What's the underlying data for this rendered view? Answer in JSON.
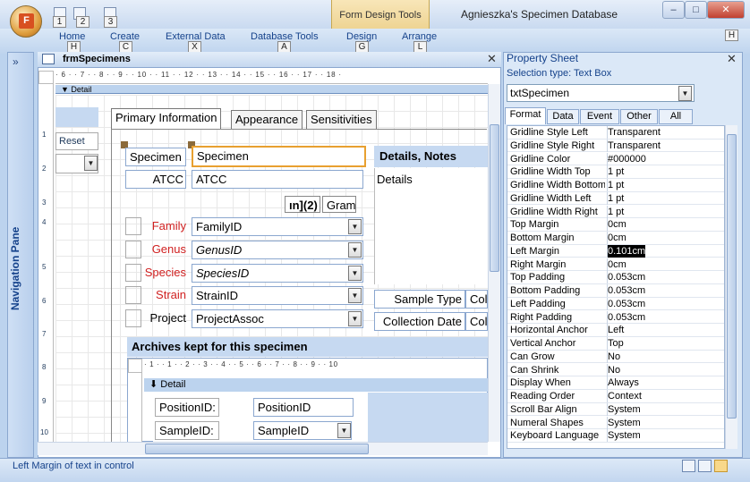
{
  "window": {
    "title": "Agnieszka's Specimen Database",
    "context_tab": "Form Design Tools",
    "min": "–",
    "max": "□",
    "close": "✕"
  },
  "office_button": {
    "label": "F"
  },
  "qat": [
    {
      "label": "1"
    },
    {
      "label": "2"
    },
    {
      "label": "3"
    }
  ],
  "ribbon": {
    "tabs": [
      {
        "label": "Home",
        "key": "H"
      },
      {
        "label": "Create",
        "key": "C"
      },
      {
        "label": "External Data",
        "key": "X"
      },
      {
        "label": "Database Tools",
        "key": "A"
      },
      {
        "label": "Design",
        "key": "G"
      },
      {
        "label": "Arrange",
        "key": "L"
      }
    ],
    "help_key": "H"
  },
  "nav": {
    "label": "Navigation Pane",
    "chevron": "»"
  },
  "document": {
    "title": "frmSpecimens",
    "close": "✕"
  },
  "ruler": {
    "marks": "· 6 · · 7 · · 8 · · 9 · · 10 · · 11 · · 12 · · 13 · · 14 · · 15 · · 16 · · 17 · · 18 ·",
    "vmarks": [
      "1",
      "2",
      "3",
      "4",
      "5",
      "6",
      "7",
      "8",
      "9",
      "10"
    ]
  },
  "form": {
    "detail_band": "▼ Detail",
    "reset": "Reset",
    "tabs": [
      "Primary Information",
      "Appearance",
      "Sensitivities"
    ],
    "fields": [
      {
        "label": "Specimen",
        "value": "Specimen"
      },
      {
        "label": "ATCC",
        "value": "ATCC"
      },
      {
        "label": "Family",
        "value": "FamilyID"
      },
      {
        "label": "Genus",
        "value": "GenusID"
      },
      {
        "label": "Species",
        "value": "SpeciesID"
      },
      {
        "label": "Strain",
        "value": "StrainID"
      },
      {
        "label": "Project",
        "value": "ProjectAssoc"
      }
    ],
    "details_header": "Details, Notes",
    "details_label": "Details",
    "btn_n2": "ın](2)",
    "btn_gram": "Gram",
    "sample_type": "Sample Type",
    "sample_type_val": "Col",
    "collection_date": "Collection Date",
    "collection_date_val": "Col",
    "archives_header": "Archives kept for this specimen",
    "subform": {
      "ruler": "· 1 · · 1 · · 2 · · 3 · · 4 · · 5 · · 6 · · 7 · · 8 · · 9 · · 10",
      "detail": "⬇ Detail",
      "position_label": "PositionID:",
      "position_value": "PositionID",
      "sample_label": "SampleID:",
      "sample_value": "SampleID"
    }
  },
  "property_sheet": {
    "title": "Property Sheet",
    "selection": "Selection type:  Text Box",
    "object": "txtSpecimen",
    "tabs": [
      "Format",
      "Data",
      "Event",
      "Other",
      "All"
    ],
    "rows": [
      [
        "Gridline Style Left",
        "Transparent"
      ],
      [
        "Gridline Style Right",
        "Transparent"
      ],
      [
        "Gridline Color",
        "#000000"
      ],
      [
        "Gridline Width Top",
        "1 pt"
      ],
      [
        "Gridline Width Bottom",
        "1 pt"
      ],
      [
        "Gridline Width Left",
        "1 pt"
      ],
      [
        "Gridline Width Right",
        "1 pt"
      ],
      [
        "Top Margin",
        "0cm"
      ],
      [
        "Bottom Margin",
        "0cm"
      ],
      [
        "Left Margin",
        "0.101cm"
      ],
      [
        "Right Margin",
        "0cm"
      ],
      [
        "Top Padding",
        "0.053cm"
      ],
      [
        "Bottom Padding",
        "0.053cm"
      ],
      [
        "Left Padding",
        "0.053cm"
      ],
      [
        "Right Padding",
        "0.053cm"
      ],
      [
        "Horizontal Anchor",
        "Left"
      ],
      [
        "Vertical Anchor",
        "Top"
      ],
      [
        "Can Grow",
        "No"
      ],
      [
        "Can Shrink",
        "No"
      ],
      [
        "Display When",
        "Always"
      ],
      [
        "Reading Order",
        "Context"
      ],
      [
        "Scroll Bar Align",
        "System"
      ],
      [
        "Numeral Shapes",
        "System"
      ],
      [
        "Keyboard Language",
        "System"
      ]
    ],
    "selected_row": 9
  },
  "status": {
    "text": "Left Margin of text in control"
  }
}
